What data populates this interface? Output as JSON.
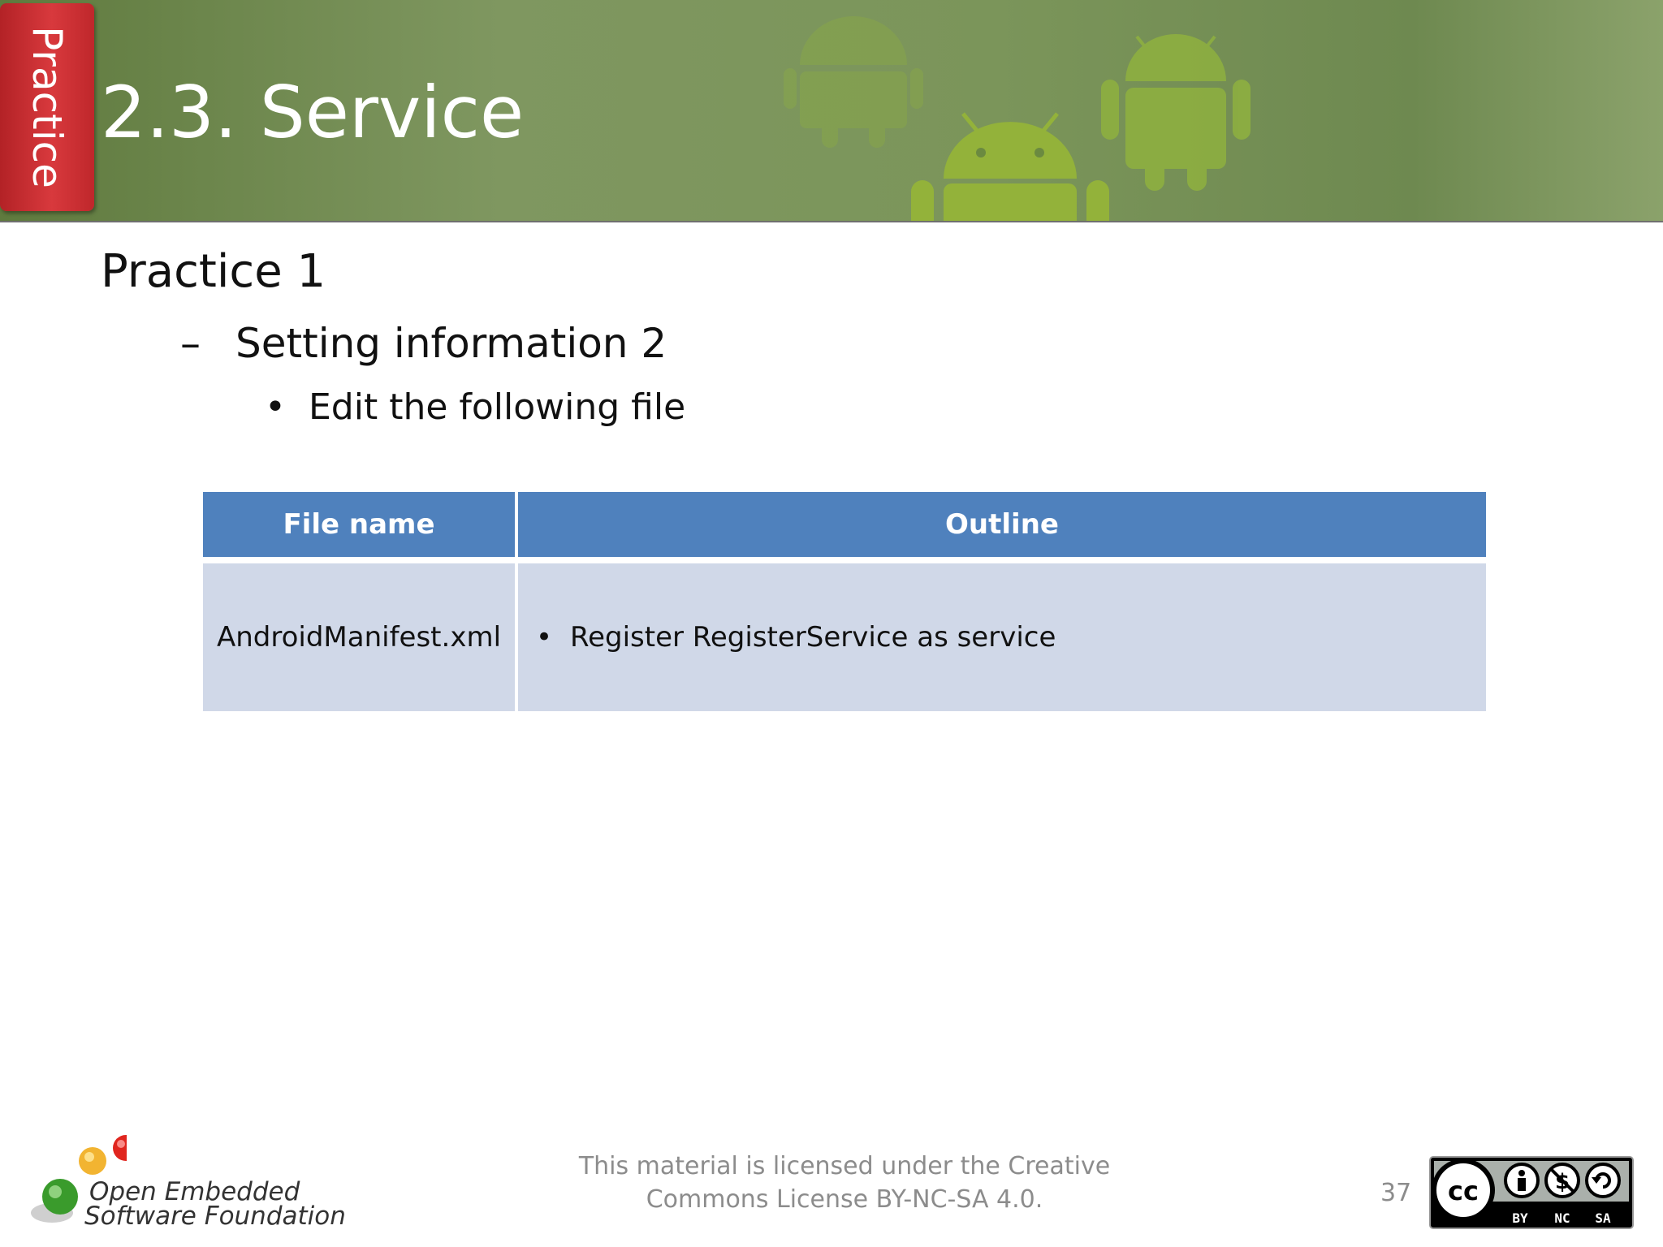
{
  "header": {
    "section_tab": "Practice",
    "title": "2.3. Service"
  },
  "content": {
    "heading": "Practice 1",
    "sub_heading": "Setting information 2",
    "sub_marker": "–",
    "bullet_marker": "•",
    "bullet": "Edit the following file"
  },
  "table": {
    "columns": [
      "File name",
      "Outline"
    ],
    "rows": [
      {
        "file": "AndroidManifest.xml",
        "outline": "Register RegisterService as service"
      }
    ]
  },
  "footer": {
    "license_line1": "This material is licensed under the Creative",
    "license_line2": "Commons License BY-NC-SA 4.0.",
    "page_number": "37",
    "logo_line1": "Open Embedded",
    "logo_line2": "Software Foundation",
    "cc_labels": [
      "BY",
      "NC",
      "SA"
    ]
  },
  "colors": {
    "header_green": "#7b955a",
    "tab_red": "#d8393d",
    "table_header": "#4f81bd",
    "table_body": "#d0d8e8"
  }
}
